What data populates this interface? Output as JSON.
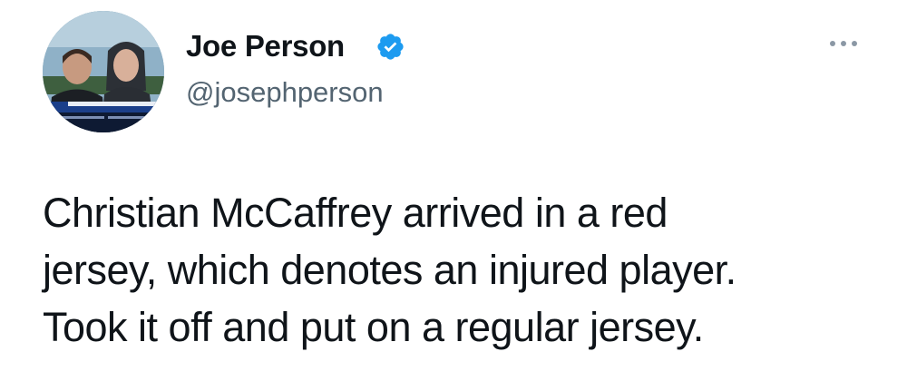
{
  "tweet": {
    "author_name": "Joe Person",
    "author_handle": "@josephperson",
    "verified": true,
    "more_icon": "more-dots-icon",
    "avatar_icon": "profile-photo",
    "text_lines": [
      "Christian McCaffrey arrived in a red",
      "jersey, which denotes an injured player.",
      "Took it off and put on a regular jersey."
    ]
  },
  "colors": {
    "verified_blue": "#1d9bf0",
    "handle_gray": "#536471",
    "text": "#0f1419"
  }
}
